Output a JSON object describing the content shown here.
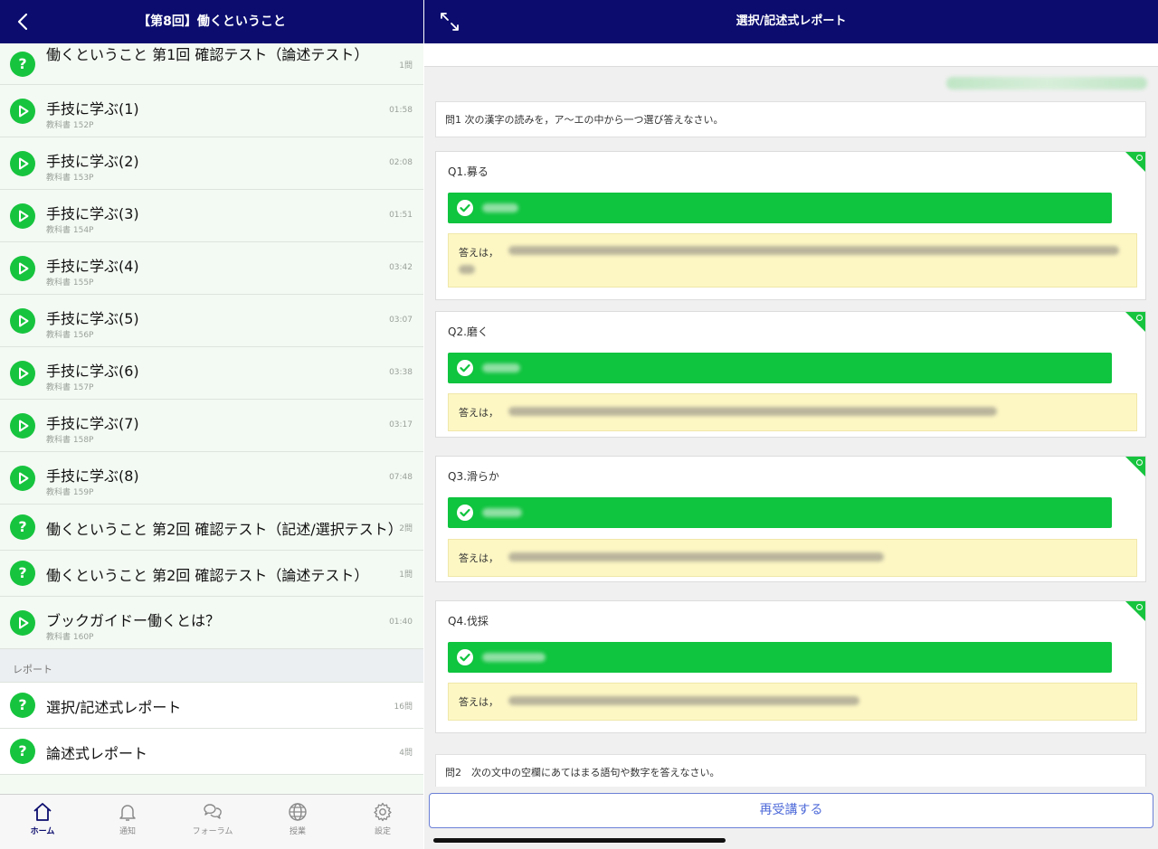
{
  "left_header": {
    "title": "【第8回】働くということ"
  },
  "lessons": [
    {
      "type": "quiz",
      "title": "働くということ 第1回 確認テスト（論述テスト）",
      "meta": "1問"
    },
    {
      "type": "video",
      "title": "手技に学ぶ(1)",
      "sub": "教科書 152P",
      "meta": "01:58"
    },
    {
      "type": "video",
      "title": "手技に学ぶ(2)",
      "sub": "教科書 153P",
      "meta": "02:08"
    },
    {
      "type": "video",
      "title": "手技に学ぶ(3)",
      "sub": "教科書 154P",
      "meta": "01:51"
    },
    {
      "type": "video",
      "title": "手技に学ぶ(4)",
      "sub": "教科書 155P",
      "meta": "03:42"
    },
    {
      "type": "video",
      "title": "手技に学ぶ(5)",
      "sub": "教科書 156P",
      "meta": "03:07"
    },
    {
      "type": "video",
      "title": "手技に学ぶ(6)",
      "sub": "教科書 157P",
      "meta": "03:38"
    },
    {
      "type": "video",
      "title": "手技に学ぶ(7)",
      "sub": "教科書 158P",
      "meta": "03:17"
    },
    {
      "type": "video",
      "title": "手技に学ぶ(8)",
      "sub": "教科書 159P",
      "meta": "07:48"
    },
    {
      "type": "quiz",
      "title": "働くということ 第2回 確認テスト（記述/選択テスト）",
      "meta": "2問"
    },
    {
      "type": "quiz",
      "title": "働くということ 第2回 確認テスト（論述テスト）",
      "meta": "1問"
    },
    {
      "type": "video",
      "title": "ブックガイドー働くとは？",
      "sub": "教科書 160P",
      "meta": "01:40"
    }
  ],
  "report_section": {
    "heading": "レポート",
    "items": [
      {
        "title": "選択/記述式レポート",
        "meta": "16問"
      },
      {
        "title": "論述式レポート",
        "meta": "4問"
      }
    ]
  },
  "tabbar": [
    {
      "label": "ホーム",
      "icon": "home-icon",
      "active": true
    },
    {
      "label": "通知",
      "icon": "bell-icon",
      "active": false
    },
    {
      "label": "フォーラム",
      "icon": "chat-icon",
      "active": false
    },
    {
      "label": "授業",
      "icon": "globe-icon",
      "active": false
    },
    {
      "label": "設定",
      "icon": "gear-icon",
      "active": false
    }
  ],
  "right_header": {
    "title": "選択/記述式レポート"
  },
  "report": {
    "prompt1": "問1 次の漢字の読みを，ア〜エの中から一つ選び答えなさい。",
    "questions": [
      {
        "title": "Q1.募る",
        "answer_prefix": "答えは，"
      },
      {
        "title": "Q2.磨く",
        "answer_prefix": "答えは，"
      },
      {
        "title": "Q3.滑らか",
        "answer_prefix": "答えは，"
      },
      {
        "title": "Q4.伐採",
        "answer_prefix": "答えは，"
      }
    ],
    "prompt2": "問2　次の文中の空欄にあてはまる語句や数字を答えなさい。"
  },
  "retake_button": "再受講する",
  "colors": {
    "navy": "#0b0c6e",
    "green": "#17c43e",
    "explain_bg": "#fdf7c4",
    "link_blue": "#4e6ad9"
  }
}
